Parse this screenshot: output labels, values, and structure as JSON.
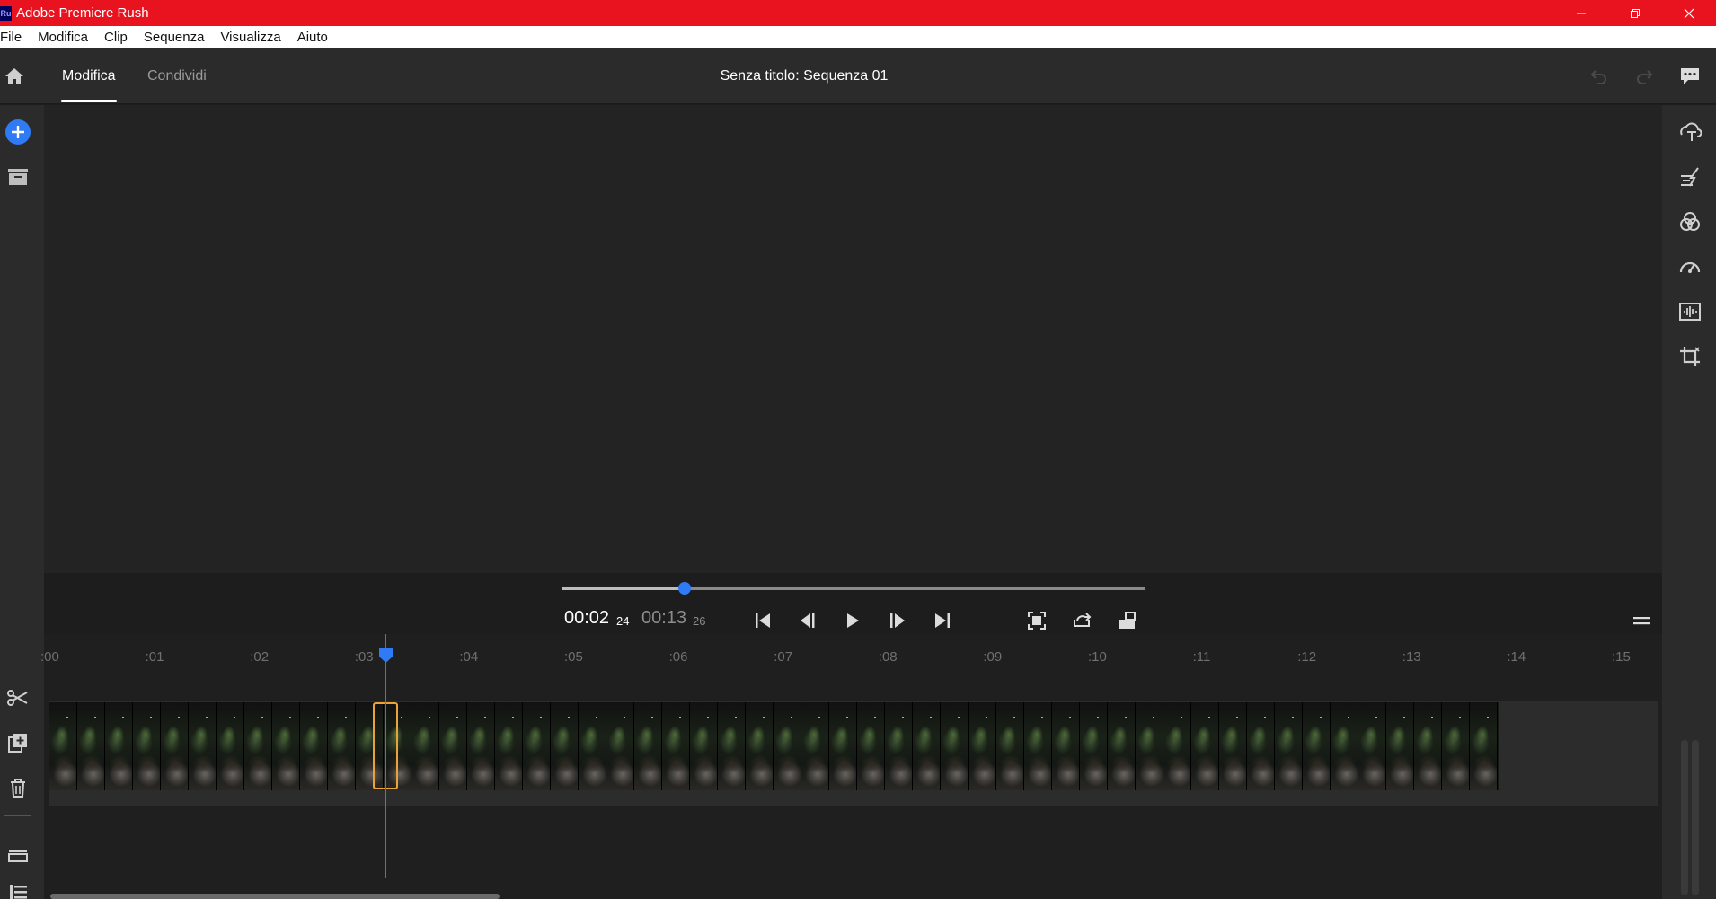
{
  "window": {
    "app_logo_text": "Ru",
    "title": "Adobe Premiere Rush",
    "controls": [
      "minimize-icon",
      "maximize-icon",
      "close-icon"
    ]
  },
  "menu": [
    "File",
    "Modifica",
    "Clip",
    "Sequenza",
    "Visualizza",
    "Aiuto"
  ],
  "header": {
    "tabs": [
      {
        "label": "Modifica",
        "active": true
      },
      {
        "label": "Condividi",
        "active": false
      }
    ],
    "sequence_title": "Senza titolo: Sequenza 01",
    "icons": [
      "home-icon",
      "undo-icon",
      "redo-icon",
      "feedback-icon"
    ]
  },
  "left_toolbar": {
    "icons": [
      "add-media-icon",
      "projects-icon",
      "split-icon",
      "duplicate-icon",
      "delete-icon",
      "track-controls-icon",
      "track-list-icon"
    ]
  },
  "right_panel": {
    "icons": [
      "titles-icon",
      "transitions-icon",
      "color-icon",
      "speed-icon",
      "audio-icon",
      "transform-icon"
    ]
  },
  "playback": {
    "current_time": "00:02",
    "current_frames": "24",
    "total_time": "00:13",
    "total_frames": "26",
    "progress_fraction": 0.21,
    "buttons": [
      "go-to-start-icon",
      "step-back-icon",
      "play-icon",
      "step-forward-icon",
      "go-to-end-icon",
      "fit-view-icon",
      "loop-icon",
      "aspect-ratio-icon"
    ],
    "menu_icon": "panel-menu-icon"
  },
  "timeline": {
    "ruler_labels": [
      ":00",
      ":01",
      ":02",
      ":03",
      ":04",
      ":05",
      ":06",
      ":07",
      ":08",
      ":09",
      ":10",
      ":11",
      ":12",
      ":13",
      ":14",
      ":15"
    ],
    "clip_count": 52,
    "selected_clip_index": 10,
    "playhead_time_seconds": 2.8
  },
  "colors": {
    "title_bar": "#e8131e",
    "accent": "#2f7bf5",
    "selection": "#e8a33b"
  }
}
